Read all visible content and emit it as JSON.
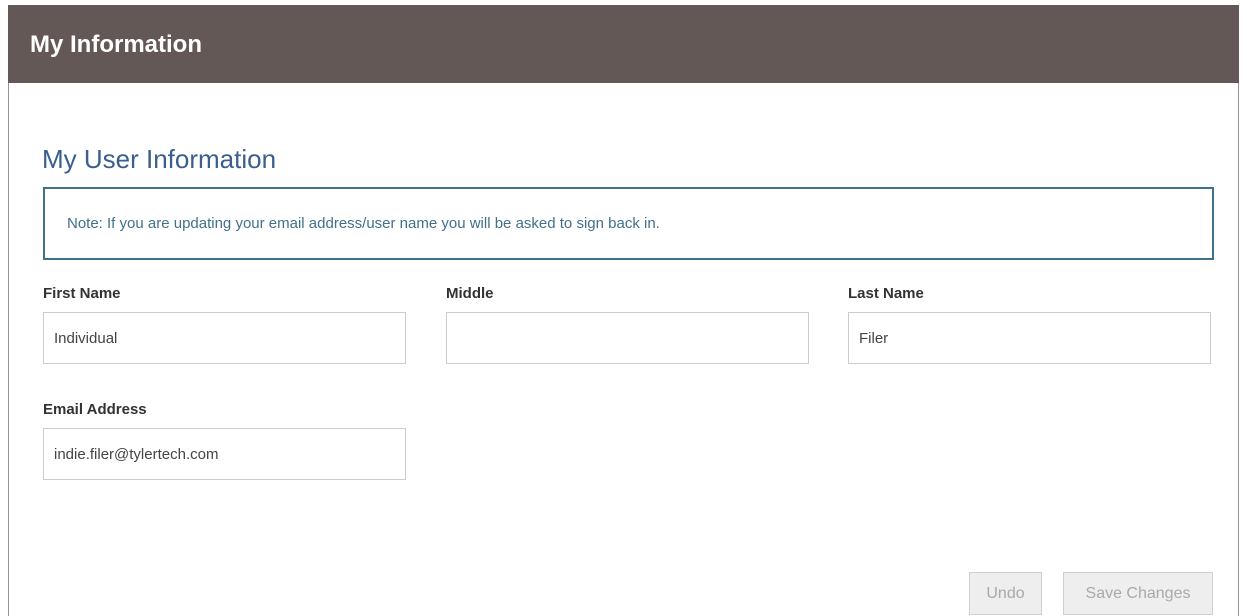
{
  "header": {
    "title": "My Information"
  },
  "section": {
    "title": "My User Information",
    "note": "Note: If you are updating your email address/user name you will be asked to sign back in."
  },
  "fields": {
    "first_name": {
      "label": "First Name",
      "value": "Individual",
      "placeholder": ""
    },
    "middle": {
      "label": "Middle",
      "value": "",
      "placeholder": ""
    },
    "last_name": {
      "label": "Last Name",
      "value": "Filer",
      "placeholder": ""
    },
    "email": {
      "label": "Email Address",
      "value": "indie.filer@tylertech.com",
      "placeholder": ""
    }
  },
  "buttons": {
    "undo": "Undo",
    "save": "Save Changes"
  },
  "colors": {
    "header_bg": "#645856",
    "section_title": "#3a5f8f",
    "note_accent": "#41708a"
  }
}
